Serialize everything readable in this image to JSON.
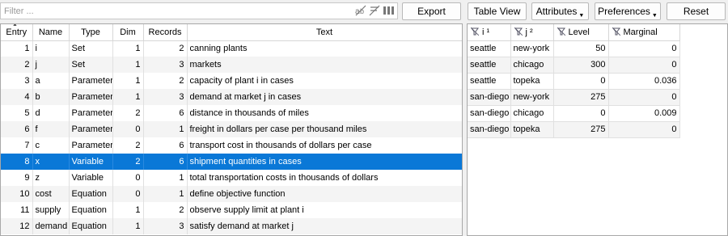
{
  "filter": {
    "placeholder": "Filter ..."
  },
  "toolbar": {
    "export_label": "Export",
    "table_view_label": "Table View",
    "attributes_label": "Attributes",
    "preferences_label": "Preferences",
    "reset_label": "Reset"
  },
  "symbols": {
    "headers": [
      "Entry",
      "Name",
      "Type",
      "Dim",
      "Records",
      "Text"
    ],
    "rows": [
      {
        "entry": "1",
        "name": "i",
        "type": "Set",
        "dim": "1",
        "records": "2",
        "text": "canning plants"
      },
      {
        "entry": "2",
        "name": "j",
        "type": "Set",
        "dim": "1",
        "records": "3",
        "text": "markets"
      },
      {
        "entry": "3",
        "name": "a",
        "type": "Parameter",
        "dim": "1",
        "records": "2",
        "text": "capacity of plant i in cases"
      },
      {
        "entry": "4",
        "name": "b",
        "type": "Parameter",
        "dim": "1",
        "records": "3",
        "text": "demand at market j in cases"
      },
      {
        "entry": "5",
        "name": "d",
        "type": "Parameter",
        "dim": "2",
        "records": "6",
        "text": "distance in thousands of miles"
      },
      {
        "entry": "6",
        "name": "f",
        "type": "Parameter",
        "dim": "0",
        "records": "1",
        "text": "freight in dollars per case per thousand miles"
      },
      {
        "entry": "7",
        "name": "c",
        "type": "Parameter",
        "dim": "2",
        "records": "6",
        "text": "transport cost in thousands of dollars per case"
      },
      {
        "entry": "8",
        "name": "x",
        "type": "Variable",
        "dim": "2",
        "records": "6",
        "text": "shipment quantities in cases"
      },
      {
        "entry": "9",
        "name": "z",
        "type": "Variable",
        "dim": "0",
        "records": "1",
        "text": "total transportation costs in thousands of dollars"
      },
      {
        "entry": "10",
        "name": "cost",
        "type": "Equation",
        "dim": "0",
        "records": "1",
        "text": "define objective function"
      },
      {
        "entry": "11",
        "name": "supply",
        "type": "Equation",
        "dim": "1",
        "records": "2",
        "text": "observe supply limit at plant i"
      },
      {
        "entry": "12",
        "name": "demand",
        "type": "Equation",
        "dim": "1",
        "records": "3",
        "text": "satisfy demand at market j"
      }
    ],
    "selected_entry": "8"
  },
  "records": {
    "headers": [
      "i ¹",
      "j ²",
      "Level",
      "Marginal"
    ],
    "rows": [
      {
        "i": "seattle",
        "j": "new-york",
        "level": "50",
        "marginal": "0"
      },
      {
        "i": "seattle",
        "j": "chicago",
        "level": "300",
        "marginal": "0"
      },
      {
        "i": "seattle",
        "j": "topeka",
        "level": "0",
        "marginal": "0.036"
      },
      {
        "i": "san-diego",
        "j": "new-york",
        "level": "275",
        "marginal": "0"
      },
      {
        "i": "san-diego",
        "j": "chicago",
        "level": "0",
        "marginal": "0.009"
      },
      {
        "i": "san-diego",
        "j": "topeka",
        "level": "275",
        "marginal": "0"
      }
    ]
  },
  "colors": {
    "selection": "#0a78d7",
    "alt_row": "#f4f4f4",
    "border": "#a8a8a8"
  }
}
